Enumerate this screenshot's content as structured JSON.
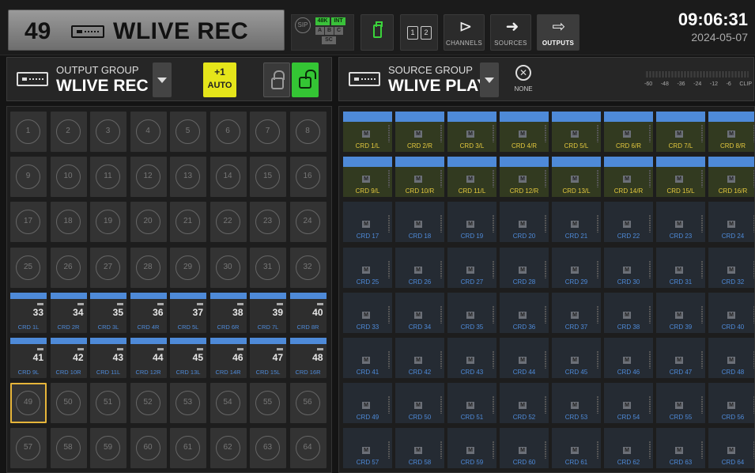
{
  "header": {
    "channel_number": "49",
    "device_name": "WLIVE REC",
    "clock": {
      "sip_label": "SIP",
      "rate": "48K",
      "source": "INT",
      "slot_a": "A",
      "slot_b": "B",
      "slot_c": "C",
      "slot_sc": "SC"
    },
    "page_1": "1",
    "page_2": "2",
    "nav": {
      "channels": "CHANNELS",
      "sources": "SOURCES",
      "outputs": "OUTPUTS"
    },
    "time": "09:06:31",
    "date": "2024-05-07"
  },
  "output_group": {
    "caption": "OUTPUT GROUP",
    "name": "WLIVE REC",
    "auto_increment": "+1",
    "auto_label": "AUTO"
  },
  "source_group": {
    "caption": "SOURCE GROUP",
    "name": "WLIVE PLAY",
    "none_label": "NONE",
    "meter_scale": [
      "-60",
      "-48",
      "-36",
      "-24",
      "-12",
      "-6",
      "CLIP"
    ]
  },
  "outputs": {
    "selected": 49,
    "patched": {
      "33": "CRD 1L",
      "34": "CRD 2R",
      "35": "CRD 3L",
      "36": "CRD 4R",
      "37": "CRD 5L",
      "38": "CRD 6R",
      "39": "CRD 7L",
      "40": "CRD 8R",
      "41": "CRD 9L",
      "42": "CRD 10R",
      "43": "CRD 11L",
      "44": "CRD 12R",
      "45": "CRD 13L",
      "46": "CRD 14R",
      "47": "CRD 15L",
      "48": "CRD 16R"
    }
  },
  "sources": {
    "mute_label": "M",
    "labels": [
      "CRD 1/L",
      "CRD 2/R",
      "CRD 3/L",
      "CRD 4/R",
      "CRD 5/L",
      "CRD 6/R",
      "CRD 7/L",
      "CRD 8/R",
      "CRD 9/L",
      "CRD 10/R",
      "CRD 11/L",
      "CRD 12/R",
      "CRD 13/L",
      "CRD 14/R",
      "CRD 15/L",
      "CRD 16/R",
      "CRD 17",
      "CRD 18",
      "CRD 19",
      "CRD 20",
      "CRD 21",
      "CRD 22",
      "CRD 23",
      "CRD 24",
      "CRD 25",
      "CRD 26",
      "CRD 27",
      "CRD 28",
      "CRD 29",
      "CRD 30",
      "CRD 31",
      "CRD 32",
      "CRD 33",
      "CRD 34",
      "CRD 35",
      "CRD 36",
      "CRD 37",
      "CRD 38",
      "CRD 39",
      "CRD 40",
      "CRD 41",
      "CRD 42",
      "CRD 43",
      "CRD 44",
      "CRD 45",
      "CRD 46",
      "CRD 47",
      "CRD 48",
      "CRD 49",
      "CRD 50",
      "CRD 51",
      "CRD 52",
      "CRD 53",
      "CRD 54",
      "CRD 55",
      "CRD 56",
      "CRD 57",
      "CRD 58",
      "CRD 59",
      "CRD 60",
      "CRD 61",
      "CRD 62",
      "CRD 63",
      "CRD 64"
    ],
    "patched_count": 16
  },
  "colors": {
    "patch_blue": "#4e8ad8",
    "selected_outline": "#e6b53a",
    "auto_yellow": "#e5e51a",
    "unlock_green": "#34c534"
  }
}
